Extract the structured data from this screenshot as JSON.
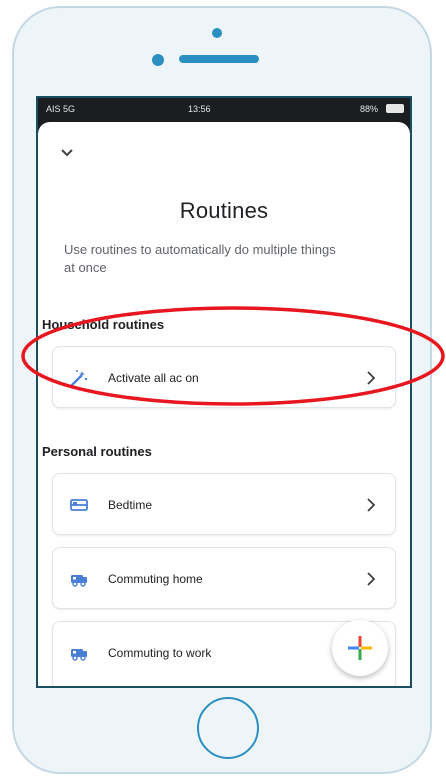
{
  "status_bar": {
    "carrier": "AIS 5G",
    "time": "13:56",
    "battery": "88%"
  },
  "header": {
    "title": "Routines",
    "subtitle": "Use routines to automatically do multiple things at once"
  },
  "household": {
    "section_label": "Household routines",
    "items": [
      {
        "label": "Activate all ac on",
        "icon": "magic-wand-icon"
      }
    ]
  },
  "personal": {
    "section_label": "Personal routines",
    "items": [
      {
        "label": "Bedtime",
        "icon": "bed-icon"
      },
      {
        "label": "Commuting home",
        "icon": "car-icon"
      },
      {
        "label": "Commuting to work",
        "icon": "car-icon"
      }
    ]
  },
  "colors": {
    "icon_blue": "#4a7fd6",
    "annotation_red": "#e8171f",
    "frame_blue": "#2c8fc1"
  }
}
